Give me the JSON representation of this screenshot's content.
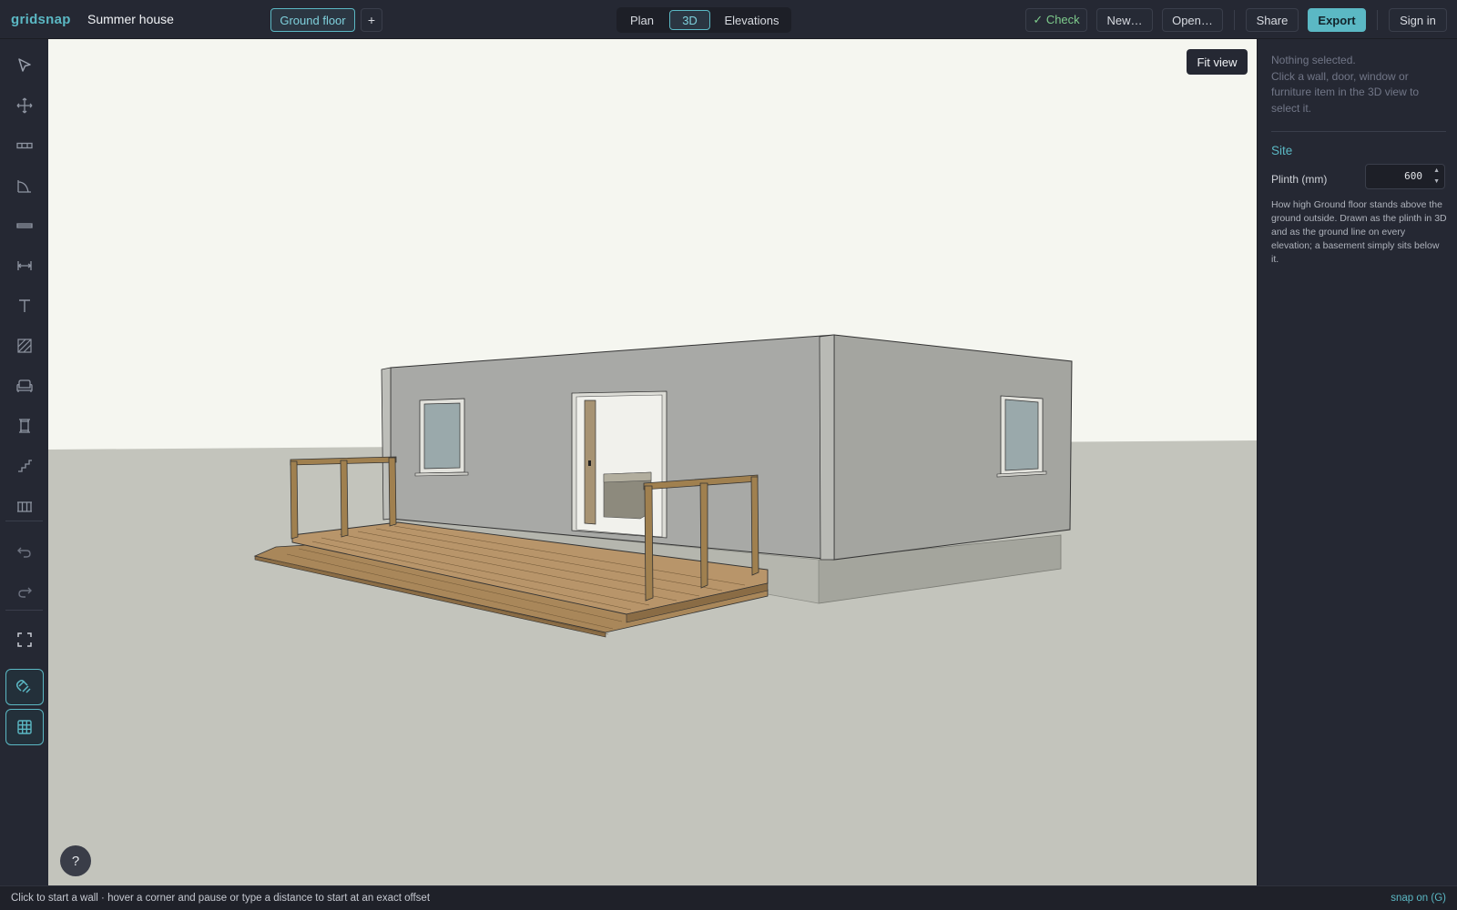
{
  "app": {
    "brand": "gridsnap",
    "project_name": "Summer house"
  },
  "header": {
    "floor_label": "Ground floor",
    "add_floor_label": "+",
    "tabs": [
      {
        "label": "Plan",
        "active": false
      },
      {
        "label": "3D",
        "active": true
      },
      {
        "label": "Elevations",
        "active": false
      }
    ],
    "check_label": "✓ Check",
    "new_label": "New…",
    "open_label": "Open…",
    "share_label": "Share",
    "export_label": "Export",
    "signin_label": "Sign in"
  },
  "toolbar": {
    "tools": [
      {
        "name": "select",
        "icon": "cursor-icon"
      },
      {
        "name": "move",
        "icon": "move-icon"
      },
      {
        "name": "wall",
        "icon": "wall-icon"
      },
      {
        "name": "room",
        "icon": "room-icon"
      },
      {
        "name": "opening",
        "icon": "opening-icon"
      },
      {
        "name": "dimension",
        "icon": "dimension-icon"
      },
      {
        "name": "text",
        "icon": "text-icon"
      },
      {
        "name": "hatch",
        "icon": "hatch-icon"
      },
      {
        "name": "furniture",
        "icon": "sofa-icon"
      },
      {
        "name": "column",
        "icon": "column-icon"
      },
      {
        "name": "stairs",
        "icon": "stairs-icon"
      },
      {
        "name": "railing",
        "icon": "railing-icon"
      },
      {
        "name": "undo",
        "icon": "undo-icon"
      },
      {
        "name": "redo",
        "icon": "redo-icon"
      },
      {
        "name": "fullscreen",
        "icon": "fullscreen-icon"
      },
      {
        "name": "snap",
        "icon": "magnet-icon",
        "active": true
      },
      {
        "name": "grid",
        "icon": "grid-icon",
        "active": true
      }
    ]
  },
  "viewport": {
    "fit_view_label": "Fit view",
    "help_label": "?"
  },
  "panel": {
    "selection_text": "Nothing selected.",
    "selection_hint": "Click a wall, door, window or furniture item in the 3D view to select it.",
    "site_heading": "Site",
    "plinth_label": "Plinth (mm)",
    "plinth_value": "600",
    "plinth_help": "How high Ground floor stands above the ground outside. Drawn as the plinth in 3D and as the ground line on every elevation; a basement simply sits below it."
  },
  "status": {
    "hint": "Click to start a wall · hover a corner and pause or type a distance to start at an exact offset",
    "snap": "snap on (G)"
  },
  "colors": {
    "accent": "#5bb8c4",
    "check_green": "#7ecb8c",
    "sky": "#f5f6f0",
    "ground": "#c3c4bc",
    "deck": "#a9875a"
  }
}
